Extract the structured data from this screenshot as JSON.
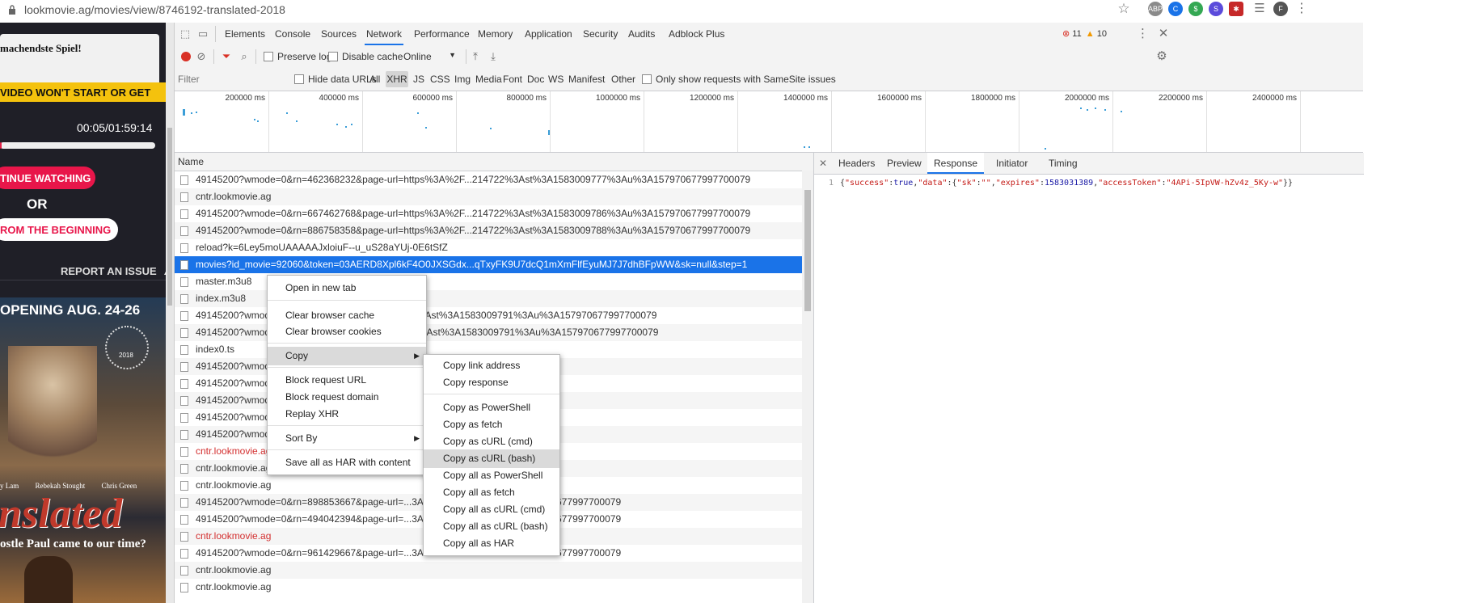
{
  "address_bar": {
    "url": "lookmovie.ag/movies/view/8746192-translated-2018",
    "profile_initial": "F"
  },
  "left_page": {
    "popup_text": "machendste Spiel!",
    "banner": "VIDEO WON'T START OR GET",
    "time": "00:05/01:59:14",
    "continue_button": "TINUE WATCHING",
    "or_text": "OR",
    "beginning_button": "ROM THE BEGINNING",
    "report": "REPORT AN ISSUE",
    "poster_heading": "OPENING AUG. 24-26",
    "poster_cast": [
      "y Lam",
      "Rebekah Stought",
      "Chris Green"
    ],
    "poster_title": "nslated",
    "poster_tagline": "ostle Paul came to our time?",
    "poster_award_year": "2018"
  },
  "devtools": {
    "tabs": [
      "Elements",
      "Console",
      "Sources",
      "Network",
      "Performance",
      "Memory",
      "Application",
      "Security",
      "Audits",
      "Adblock Plus"
    ],
    "active_tab": "Network",
    "error_count": "11",
    "warning_count": "10",
    "toolbar": {
      "preserve_log": "Preserve log",
      "disable_cache": "Disable cache",
      "throttle": "Online"
    },
    "filter_bar": {
      "placeholder": "Filter",
      "hide_data_urls": "Hide data URLs",
      "types": [
        "All",
        "XHR",
        "JS",
        "CSS",
        "Img",
        "Media",
        "Font",
        "Doc",
        "WS",
        "Manifest",
        "Other"
      ],
      "active_type": "XHR",
      "samesite": "Only show requests with SameSite issues"
    },
    "overview_ticks": [
      "200000 ms",
      "400000 ms",
      "600000 ms",
      "800000 ms",
      "1000000 ms",
      "1200000 ms",
      "1400000 ms",
      "1600000 ms",
      "1800000 ms",
      "2000000 ms",
      "2200000 ms",
      "2400000 ms"
    ],
    "list_header": "Name",
    "requests": [
      {
        "name": "49145200?wmode=0&rn=462368232&page-url=https%3A%2F...214722%3Ast%3A1583009777%3Au%3A157970677997700079"
      },
      {
        "name": "cntr.lookmovie.ag"
      },
      {
        "name": "49145200?wmode=0&rn=667462768&page-url=https%3A%2F...214722%3Ast%3A1583009786%3Au%3A157970677997700079"
      },
      {
        "name": "49145200?wmode=0&rn=886758358&page-url=https%3A%2F...214722%3Ast%3A1583009788%3Au%3A157970677997700079"
      },
      {
        "name": "reload?k=6Ley5moUAAAAAJxloiuF--u_uS28aYUj-0E6tSfZ"
      },
      {
        "name": "movies?id_movie=92060&token=03AERD8Xpl6kF4O0JXSGdx...qTxyFK9U7dcQ1mXmFlfEyuMJ7J7dhBFpWW&sk=null&step=1",
        "selected": true
      },
      {
        "name": "master.m3u8"
      },
      {
        "name": "index.m3u8"
      },
      {
        "name": "49145200?wmode=0&rn=...ttps%3A%2F...214722%3Ast%3A1583009791%3Au%3A157970677997700079"
      },
      {
        "name": "49145200?wmode=0&rn=...ttps%3A%2F...bt%3A1%3Ast%3A1583009791%3Au%3A157970677997700079"
      },
      {
        "name": "index0.ts"
      },
      {
        "name": "49145200?wmode=0&rn=...3A1583009793%3Au%3A157970677997700079"
      },
      {
        "name": "49145200?wmode=0&rn=...3A1583009796%3Au%3A157970677997700079"
      },
      {
        "name": "49145200?wmode=0&rn=...3A1583009802%3Au%3A157970677997700079"
      },
      {
        "name": "49145200?wmode=0&rn=...3A1583009820%3Au%3A157970677997700079"
      },
      {
        "name": "49145200?wmode=0&rn=...3A1583009838%3Au%3A157970677997700079"
      },
      {
        "name": "cntr.lookmovie.ag",
        "error": true
      },
      {
        "name": "cntr.lookmovie.ag"
      },
      {
        "name": "cntr.lookmovie.ag"
      },
      {
        "name": "49145200?wmode=0&rn=898853667&page-url=...3A1583009988%3Au%3A157970677997700079"
      },
      {
        "name": "49145200?wmode=0&rn=494042394&page-url=...3A1583009995%3Au%3A157970677997700079"
      },
      {
        "name": "cntr.lookmovie.ag",
        "error": true
      },
      {
        "name": "49145200?wmode=0&rn=961429667&page-url=...3A1583010071%3Au%3A157970677997700079"
      },
      {
        "name": "cntr.lookmovie.ag"
      },
      {
        "name": "cntr.lookmovie.ag"
      }
    ],
    "response_tabs": [
      "Headers",
      "Preview",
      "Response",
      "Initiator",
      "Timing"
    ],
    "active_response_tab": "Response",
    "response_line_number": "1",
    "response": {
      "p1": "{",
      "k_success": "\"success\"",
      "p2": ":",
      "v_success": "true",
      "p3": ",",
      "k_data": "\"data\"",
      "p4": ":{",
      "k_sk": "\"sk\"",
      "p5": ":",
      "v_sk": "\"\"",
      "p6": ",",
      "k_expires": "\"expires\"",
      "p7": ":",
      "v_expires": "1583031389",
      "p8": ",",
      "k_token": "\"accessToken\"",
      "p9": ":",
      "v_token": "\"4APi-5IpVW-hZv4z_5Ky-w\"",
      "p10": "}}"
    }
  },
  "context_menu": {
    "items": [
      "Open in new tab",
      "Clear browser cache",
      "Clear browser cookies",
      "Copy",
      "Block request URL",
      "Block request domain",
      "Replay XHR",
      "Sort By",
      "Save all as HAR with content"
    ],
    "highlighted": "Copy"
  },
  "copy_submenu": {
    "items": [
      "Copy link address",
      "Copy response",
      "Copy as PowerShell",
      "Copy as fetch",
      "Copy as cURL (cmd)",
      "Copy as cURL (bash)",
      "Copy all as PowerShell",
      "Copy all as fetch",
      "Copy all as cURL (cmd)",
      "Copy all as cURL (bash)",
      "Copy all as HAR"
    ],
    "highlighted": "Copy as cURL (bash)"
  },
  "colors": {
    "selection": "#1a73e8",
    "record_red": "#d93025",
    "json_key": "#c41a16",
    "json_number": "#1a1aa6",
    "error_text": "#d32f2f"
  }
}
